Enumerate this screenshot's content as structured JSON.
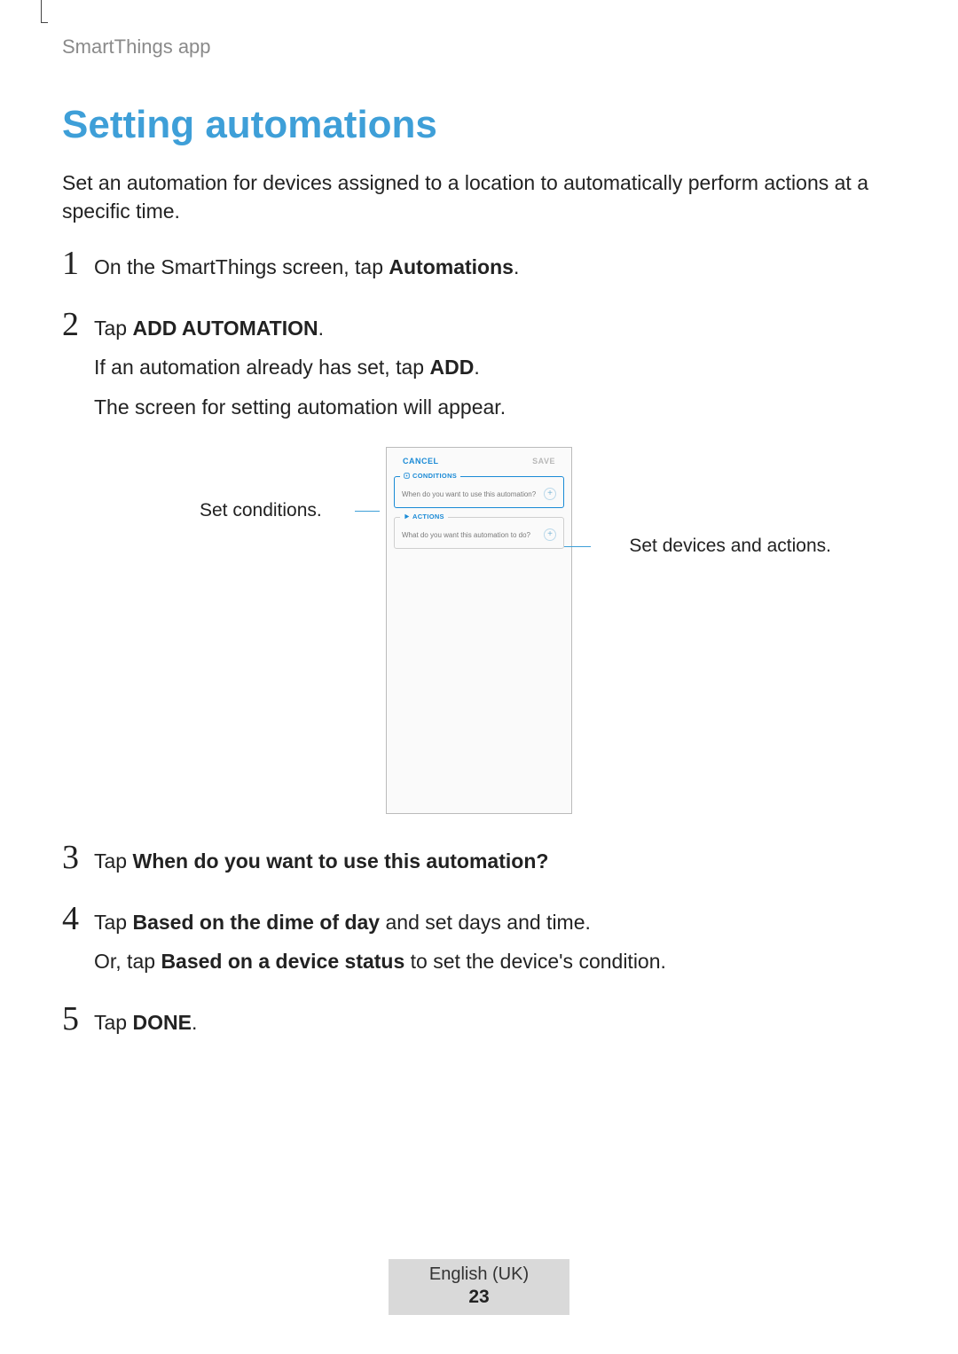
{
  "header": {
    "section": "SmartThings app"
  },
  "title": "Setting automations",
  "intro": "Set an automation for devices assigned to a location to automatically perform actions at a specific time.",
  "steps": {
    "s1": {
      "num": "1",
      "text_a": "On the SmartThings screen, tap ",
      "bold_a": "Automations",
      "text_b": "."
    },
    "s2": {
      "num": "2",
      "line1_a": "Tap ",
      "line1_bold": "ADD AUTOMATION",
      "line1_b": ".",
      "line2_a": "If an automation already has set, tap ",
      "line2_bold": "ADD",
      "line2_b": ".",
      "line3": "The screen for setting automation will appear."
    },
    "s3": {
      "num": "3",
      "text_a": "Tap ",
      "bold_a": "When do you want to use this automation?"
    },
    "s4": {
      "num": "4",
      "line1_a": "Tap ",
      "line1_bold": "Based on the dime of day",
      "line1_b": " and set days and time.",
      "line2_a": "Or, tap ",
      "line2_bold": "Based on a device status",
      "line2_b": " to set the device's condition."
    },
    "s5": {
      "num": "5",
      "text_a": "Tap ",
      "bold_a": "DONE",
      "text_b": "."
    }
  },
  "callouts": {
    "left": "Set conditions.",
    "right": "Set devices and actions."
  },
  "phone": {
    "cancel": "CANCEL",
    "save": "SAVE",
    "conditions_legend": "CONDITIONS",
    "conditions_text": "When do you want to use this automation?",
    "actions_legend": "ACTIONS",
    "actions_text": "What do you want this automation to do?",
    "plus": "+"
  },
  "footer": {
    "lang": "English (UK)",
    "page": "23"
  }
}
